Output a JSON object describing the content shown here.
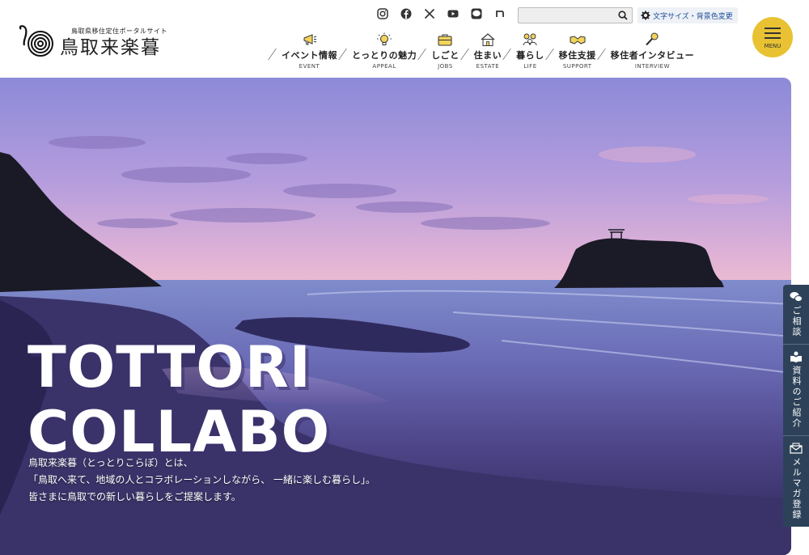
{
  "site": {
    "subtitle": "鳥取県移住定住ポータルサイト",
    "name": "鳥取来楽暮"
  },
  "social": [
    "instagram-icon",
    "facebook-icon",
    "x-icon",
    "youtube-icon",
    "line-icon",
    "note-icon"
  ],
  "search": {
    "placeholder": "",
    "value": ""
  },
  "font_size_button": "文字サイズ・背景色変更",
  "menu_label": "MENU",
  "nav": [
    {
      "label": "イベント情報",
      "en": "EVENT",
      "icon": "megaphone-icon"
    },
    {
      "label": "とっとりの魅力",
      "en": "APPEAL",
      "icon": "lightbulb-icon"
    },
    {
      "label": "しごと",
      "en": "JOBS",
      "icon": "briefcase-icon"
    },
    {
      "label": "住まい",
      "en": "ESTATE",
      "icon": "house-icon"
    },
    {
      "label": "暮らし",
      "en": "LIFE",
      "icon": "family-icon"
    },
    {
      "label": "移住支援",
      "en": "SUPPORT",
      "icon": "handshake-icon"
    },
    {
      "label": "移住者インタビュー",
      "en": "INTERVIEW",
      "icon": "microphone-icon"
    }
  ],
  "hero": {
    "title_line1": "TOTTORI",
    "title_line2": "COLLABO",
    "desc_line1": "鳥取来楽暮（とっとりこらぼ）とは、",
    "desc_line2": "「鳥取へ来て、地域の人とコラボレーションしながら、 一緒に楽しむ暮らし」。",
    "desc_line3": "皆さまに鳥取での新しい暮らしをご提案します。"
  },
  "side_tabs": [
    {
      "label": "ご相談",
      "icon": "chat-icon"
    },
    {
      "label": "資料のご紹介",
      "icon": "book-icon"
    },
    {
      "label": "メルマガ登録",
      "icon": "mail-icon"
    }
  ],
  "colors": {
    "accent": "#e8c233",
    "side_tab": "#2d4259",
    "link": "#1d4d9a"
  }
}
